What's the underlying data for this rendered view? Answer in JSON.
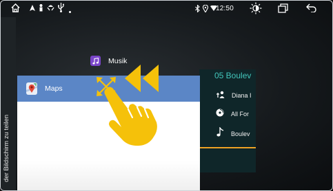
{
  "statusbar": {
    "time": "12:50",
    "icons": [
      "home-icon",
      "location-arrow-icon",
      "person-icon",
      "ufo-icon",
      "usb-icon",
      "dot-icon",
      "bluetooth-icon",
      "location-pin-icon",
      "wifi-icon",
      "brightness-icon",
      "recents-icon",
      "back-icon"
    ]
  },
  "split_screen_hint": "der Bildschirm zu teilen",
  "musik_card": {
    "label": "Musik",
    "icon": "music-note-icon"
  },
  "maps_card": {
    "label": "Maps",
    "icon": "maps-pin-icon",
    "header_color": "#5b86c6"
  },
  "music_panel": {
    "title": "05 Boulev",
    "rows": [
      {
        "icon": "artist-icon",
        "label": "Diana I"
      },
      {
        "icon": "album-icon",
        "label": "All For"
      },
      {
        "icon": "song-note-icon",
        "label": "Boulev"
      }
    ],
    "accent": "#43c6bb",
    "progress_color": "#f0a224"
  },
  "gesture": {
    "color": "#f5c10a",
    "icons": [
      "double-chevron-left-icon",
      "move-arrows-icon",
      "pointing-hand-icon"
    ]
  }
}
